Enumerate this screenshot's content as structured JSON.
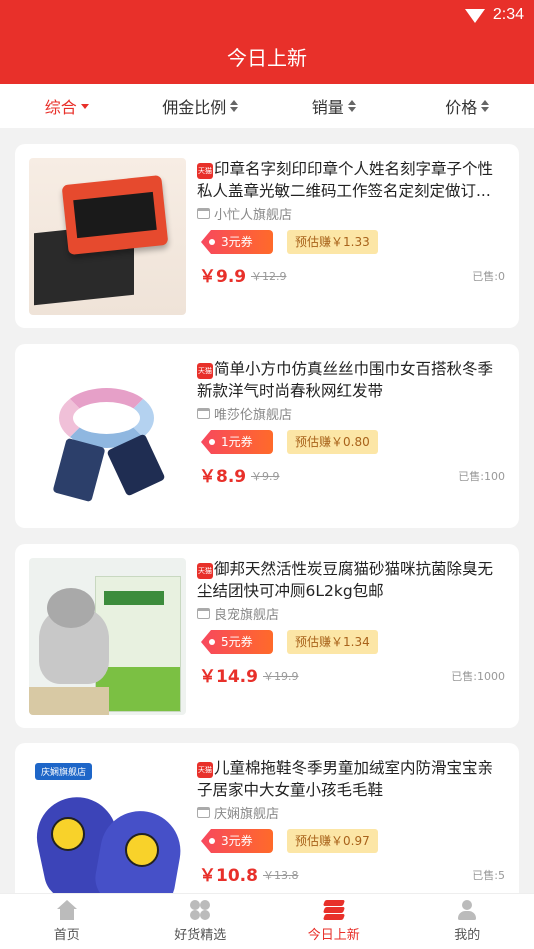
{
  "status": {
    "time": "2:34"
  },
  "header": {
    "title": "今日上新"
  },
  "sort": {
    "items": [
      {
        "label": "综合",
        "active": true
      },
      {
        "label": "佣金比例",
        "active": false
      },
      {
        "label": "销量",
        "active": false
      },
      {
        "label": "价格",
        "active": false
      }
    ]
  },
  "products": [
    {
      "platform_badge": "天猫",
      "name": "印章名字刻印印章个人姓名刻字章子个性私人盖章光敏二维码工作签名定刻定做订...",
      "shop": "小忙人旗舰店",
      "coupon": "3元券",
      "earn": "预估赚￥1.33",
      "price": "￥9.9",
      "original_price": "￥12.9",
      "sold": "已售:0"
    },
    {
      "platform_badge": "天猫",
      "name": "简单小方巾仿真丝丝巾围巾女百搭秋冬季新款洋气时尚春秋网红发带",
      "shop": "唯莎伦旗舰店",
      "coupon": "1元券",
      "earn": "预估赚￥0.80",
      "price": "￥8.9",
      "original_price": "￥9.9",
      "sold": "已售:100"
    },
    {
      "platform_badge": "天猫",
      "name": "御邦天然活性炭豆腐猫砂猫咪抗菌除臭无尘结团快可冲厕6L2kg包邮",
      "shop": "良宠旗舰店",
      "coupon": "5元券",
      "earn": "预估赚￥1.34",
      "price": "￥14.9",
      "original_price": "￥19.9",
      "sold": "已售:1000"
    },
    {
      "platform_badge": "天猫",
      "name": "儿童棉拖鞋冬季男童加绒室内防滑宝宝亲子居家中大女童小孩毛毛鞋",
      "shop": "庆娴旗舰店",
      "coupon": "3元券",
      "earn": "预估赚￥0.97",
      "price": "￥10.8",
      "original_price": "￥13.8",
      "sold": "已售:5",
      "image_badge": "庆娴旗舰店"
    }
  ],
  "bottom_nav": [
    {
      "label": "首页",
      "icon": "home-icon",
      "active": false
    },
    {
      "label": "好货精选",
      "icon": "clover-icon",
      "active": false
    },
    {
      "label": "今日上新",
      "icon": "layers-icon",
      "active": true
    },
    {
      "label": "我的",
      "icon": "user-icon",
      "active": false
    }
  ],
  "colors": {
    "brand": "#e8302a",
    "earn_bg": "#fce6a6",
    "earn_text": "#a8621a"
  }
}
